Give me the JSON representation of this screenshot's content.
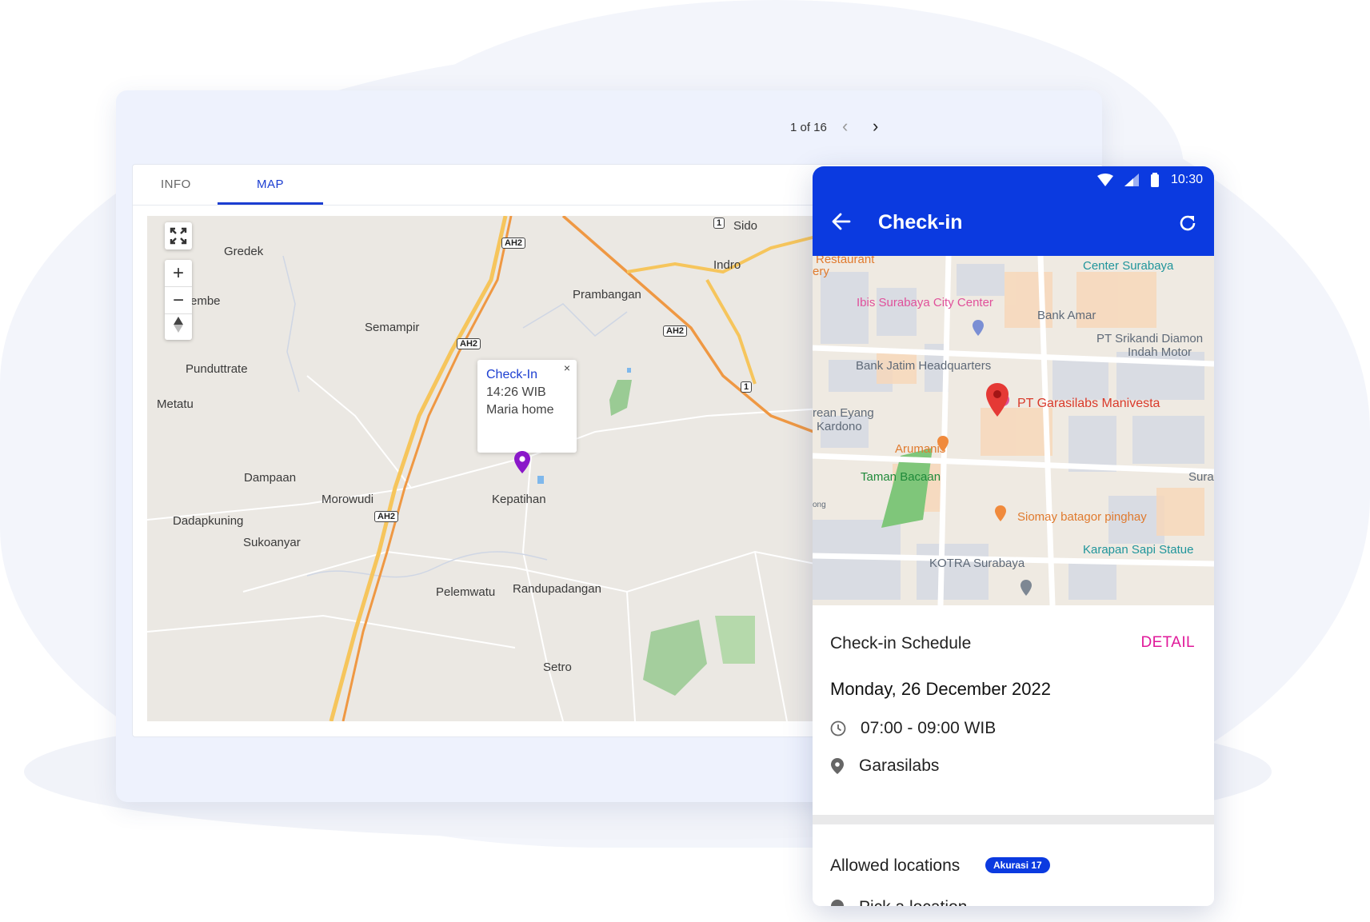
{
  "desktop": {
    "pager_text": "1 of 16",
    "prev_icon": "chevron-left-icon",
    "next_icon": "chevron-right-icon",
    "tabs": [
      {
        "label": "INFO"
      },
      {
        "label": "MAP"
      }
    ],
    "map": {
      "labels": [
        "Gredek",
        "embe",
        "Semampir",
        "Punduttrate",
        "Metatu",
        "Dampaan",
        "Morowudi",
        "Dadapkuning",
        "Sukoanyar",
        "Kepatihan",
        "Prambangan",
        "Indro",
        "Sido",
        "Pelemwatu",
        "Randupadangan",
        "Setro"
      ],
      "shields": [
        "AH2",
        "AH2",
        "AH2",
        "AH2",
        "1",
        "1"
      ],
      "zoom_in": "+",
      "zoom_out": "−",
      "popup": {
        "title": "Check-In",
        "time": "14:26 WIB",
        "place": "Maria home",
        "close": "×"
      }
    }
  },
  "phone": {
    "status_time": "10:30",
    "title": "Check-in",
    "map_labels": [
      "Restaurant",
      "ery",
      "Center Surabaya",
      "Ibis Surabaya City Center",
      "Bank Amar",
      "PT Srikandi Diamon",
      "Indah Motor",
      "Bank Jatim Headquarters",
      "rean Eyang",
      "Kardono",
      "PT Garasilabs Manivesta",
      "Arumanis",
      "Taman Bacaan",
      "Surab",
      "Siomay batagor pinghay",
      "Karapan Sapi Statue",
      "KOTRA Surabaya",
      "ong"
    ],
    "schedule": {
      "title": "Check-in Schedule",
      "detail": "DETAIL",
      "date": "Monday, 26 December 2022",
      "time": "07:00 - 09:00 WIB",
      "location": "Garasilabs"
    },
    "allowed": {
      "title": "Allowed locations",
      "badge": "Akurasi 17",
      "first_item": "Pick a location"
    },
    "colors": {
      "primary": "#0b3ae0",
      "accent": "#e0189a"
    }
  }
}
